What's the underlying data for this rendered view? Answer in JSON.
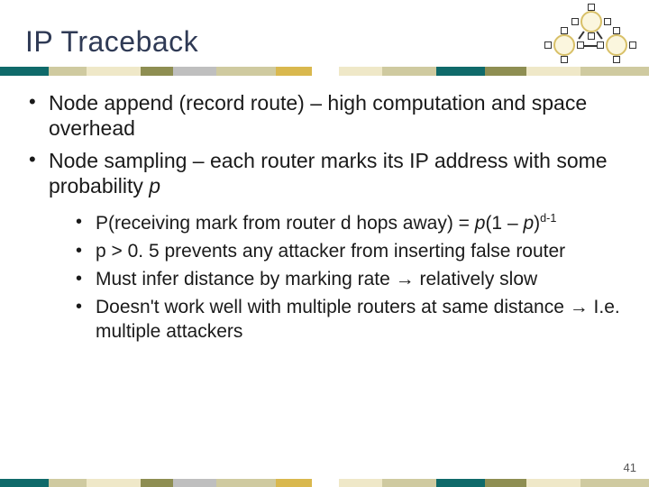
{
  "title": "IP Traceback",
  "bullets": {
    "level1": [
      "Node append (record route) – high computation and space overhead",
      "Node sampling – each router marks its IP address with some probability "
    ],
    "p_var": "p",
    "level2": {
      "b0_pre": "P(receiving mark from router d hops away) = ",
      "b0_p1": "p",
      "b0_mid": "(1 – ",
      "b0_p2": "p",
      "b0_close": ")",
      "b0_exp": "d-1",
      "b1": "p > 0. 5 prevents any attacker from inserting false router",
      "b2_pre": "Must infer distance by marking rate ",
      "arrow": "→",
      "b2_post": " relatively slow",
      "b3_pre": "Doesn't work well with multiple routers at same distance ",
      "b3_post": " I.e. multiple attackers"
    }
  },
  "page_number": "41",
  "band_colors": {
    "teal": "#0f6a6a",
    "tan": "#cfcaa0",
    "olive": "#8e8e52",
    "gold": "#d9b84e",
    "cream": "#efe8c8",
    "grey": "#bfbfbf",
    "white": "#ffffff"
  }
}
